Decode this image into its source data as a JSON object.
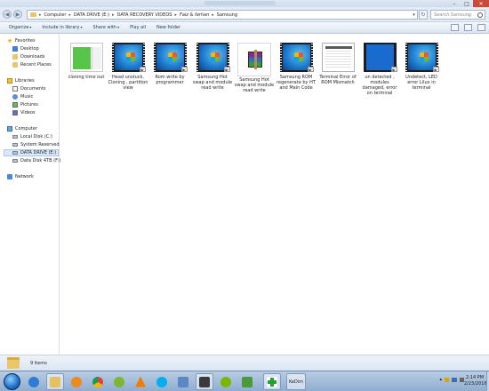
{
  "window": {
    "controls": {
      "minimize": "–",
      "maximize": "□",
      "close": "✕"
    }
  },
  "address": {
    "back_glyph": "◀",
    "forward_glyph": "▶",
    "separator": "▸",
    "crumbs": [
      "Computer",
      "DATA DRIVE (E:)",
      "DATA RECOVERY VIDEOS",
      "Faiz & farhan",
      "Samsung"
    ],
    "dropdown_glyph": "▾",
    "refresh_glyph": "↻",
    "search_placeholder": "Search Samsung"
  },
  "toolbar": {
    "buttons": [
      "Organize",
      "Include in library",
      "Share with",
      "Play all",
      "New folder"
    ],
    "caret": "▾"
  },
  "navpane": {
    "favorites_label": "Favorites",
    "favorites": [
      "Desktop",
      "Downloads",
      "Recent Places"
    ],
    "libraries_label": "Libraries",
    "libraries": [
      "Documents",
      "Music",
      "Pictures",
      "Videos"
    ],
    "computer_label": "Computer",
    "drives": [
      "Local Disk (C:)",
      "System Reserved (D:)",
      "DATA DRIVE (E:)",
      "Data Disk 4TB (F:)"
    ],
    "network_label": "Network"
  },
  "files": [
    {
      "name": "cloning time out",
      "thumb": "green-screen"
    },
    {
      "name": "Head unstuck, Cloning , partition view",
      "thumb": "video"
    },
    {
      "name": "Rom write by programmer",
      "thumb": "video"
    },
    {
      "name": "Samsung Hot swap and module read write",
      "thumb": "video"
    },
    {
      "name": "Samsung Hot swap and module read write",
      "thumb": "rar-archive"
    },
    {
      "name": "Samsung ROM regenerate by HT and Main Code",
      "thumb": "video"
    },
    {
      "name": "Terminal Error of ROM Mismatch",
      "thumb": "document"
    },
    {
      "name": "un detected , modules damaged, error on terminal",
      "thumb": "blue-screen"
    },
    {
      "name": "Undetect,  LED error Lilux in terminal",
      "thumb": "video"
    }
  ],
  "details": {
    "item_count": "9 items"
  },
  "taskbar": {
    "apps": [
      "start-orb",
      "internet-explorer-icon",
      "file-explorer-icon",
      "media-player-icon",
      "chrome-icon",
      "sketchup-icon",
      "vlc-icon",
      "skype-icon",
      "printer-icon",
      "utorrent-icon",
      "xvideo-icon",
      "green-plus-icon",
      "kedim-icon"
    ],
    "kedim_label": "KeDim",
    "time": "2:14 PM",
    "date": "2/23/2016"
  }
}
